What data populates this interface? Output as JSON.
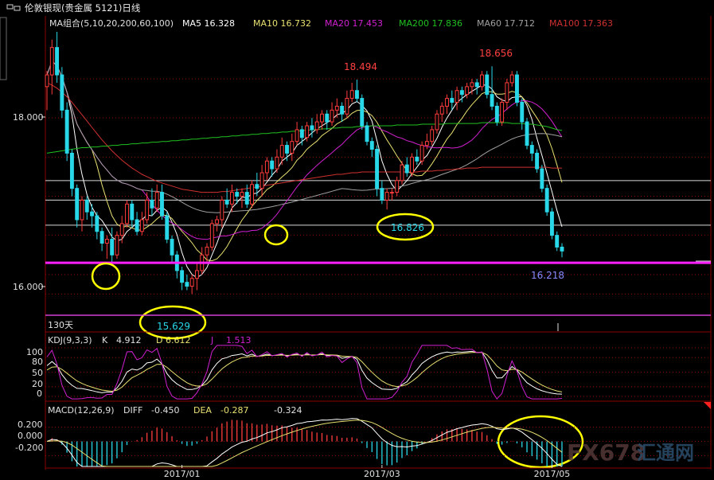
{
  "window": {
    "title": "伦敦银现(贵金属 5121)日线"
  },
  "ma_legend": {
    "group_label": "MA组合(5,10,20,200,60,100)",
    "items": [
      {
        "label": "MA5 16.328",
        "color": "#ffffff"
      },
      {
        "label": "MA10 16.732",
        "color": "#e8e070"
      },
      {
        "label": "MA20 17.453",
        "color": "#d020d0"
      },
      {
        "label": "MA200 17.836",
        "color": "#20c020"
      },
      {
        "label": "MA60 17.712",
        "color": "#a0a0a0"
      },
      {
        "label": "MA100 17.363",
        "color": "#d03030"
      }
    ]
  },
  "price_panel": {
    "y_ticks": [
      "18.000",
      "16.000"
    ],
    "high_labels": [
      "18.494",
      "18.656"
    ],
    "low_labels": [
      "15.629",
      "16.826",
      "16.218"
    ],
    "period_label": "130天"
  },
  "kdj": {
    "label": "KDJ(9,3,3)",
    "k_label": "K",
    "k_value": "4.912",
    "d_label": "D",
    "d_value": "6.612",
    "j_label": "J",
    "j_value": "1.513",
    "y_ticks": [
      "100",
      "80",
      "50",
      "20",
      "0"
    ]
  },
  "macd": {
    "label": "MACD(12,26,9)",
    "diff_label": "DIFF",
    "diff_value": "-0.450",
    "dea_label": "DEA",
    "dea_value": "-0.287",
    "macd_value": "-0.324",
    "y_ticks": [
      "0.200",
      "0.000",
      "-0.200"
    ]
  },
  "x_axis": {
    "ticks": [
      "2017/01",
      "2017/03",
      "2017/05"
    ]
  },
  "watermark": {
    "text": "FX678",
    "subtext": "汇通网"
  },
  "colors": {
    "up": "#ff3c3c",
    "down": "#28d8e8",
    "support": "#ff20ff",
    "highlight": "#ffff00",
    "grid": "#8a0000"
  },
  "chart_data": {
    "type": "candlestick",
    "title": "伦敦银现(贵金属 5121)日线",
    "ylim": [
      15.5,
      19.1
    ],
    "support_level": 16.15,
    "horizontal_lines": [
      17.2,
      16.95,
      16.63
    ],
    "x_ticks": [
      "2017/01",
      "2017/03",
      "2017/05"
    ],
    "x_tick_index": [
      27,
      67,
      101
    ],
    "candles": {
      "open": [
        18.4,
        18.55,
        18.9,
        18.55,
        18.1,
        17.55,
        17.1,
        16.7,
        16.95,
        16.8,
        16.75,
        16.55,
        16.4,
        16.45,
        16.25,
        16.5,
        16.65,
        16.9,
        16.7,
        16.55,
        16.7,
        16.95,
        16.85,
        17.05,
        16.75,
        16.45,
        16.25,
        16.05,
        15.9,
        15.85,
        15.95,
        16.05,
        16.25,
        16.35,
        16.65,
        16.7,
        16.95,
        16.9,
        17.05,
        17.0,
        17.05,
        16.9,
        17.15,
        17.1,
        17.3,
        17.45,
        17.35,
        17.5,
        17.65,
        17.55,
        17.7,
        17.85,
        17.75,
        17.9,
        17.85,
        17.95,
        18.05,
        17.95,
        18.1,
        18.15,
        18.05,
        18.25,
        18.35,
        18.25,
        17.9,
        17.7,
        17.6,
        17.1,
        16.95,
        17.05,
        17.05,
        17.2,
        17.4,
        17.3,
        17.5,
        17.45,
        17.65,
        17.7,
        17.85,
        18.05,
        18.15,
        18.25,
        18.2,
        18.35,
        18.3,
        18.4,
        18.45,
        18.4,
        18.55,
        18.3,
        18.15,
        17.95,
        18.2,
        18.45,
        18.55,
        18.2,
        17.95,
        17.65,
        17.55,
        17.35,
        17.1,
        16.8,
        16.5,
        16.35
      ],
      "high": [
        18.6,
        19.0,
        19.1,
        18.65,
        18.2,
        17.6,
        17.15,
        17.0,
        17.0,
        16.9,
        16.8,
        16.6,
        16.5,
        16.6,
        16.55,
        16.75,
        16.95,
        16.95,
        16.8,
        16.8,
        17.05,
        17.1,
        17.15,
        17.15,
        16.8,
        16.5,
        16.3,
        16.1,
        16.0,
        16.0,
        16.15,
        16.35,
        16.4,
        16.7,
        16.75,
        17.0,
        17.1,
        17.15,
        17.1,
        17.1,
        17.15,
        17.2,
        17.3,
        17.4,
        17.5,
        17.5,
        17.6,
        17.75,
        17.7,
        17.8,
        17.95,
        17.9,
        17.95,
        18.0,
        18.05,
        18.1,
        18.1,
        18.2,
        18.25,
        18.2,
        18.35,
        18.45,
        18.49,
        18.3,
        17.95,
        17.75,
        17.65,
        17.2,
        17.1,
        17.1,
        17.25,
        17.45,
        17.5,
        17.55,
        17.6,
        17.7,
        17.8,
        17.9,
        18.1,
        18.2,
        18.3,
        18.35,
        18.4,
        18.4,
        18.45,
        18.5,
        18.5,
        18.6,
        18.6,
        18.66,
        18.2,
        18.25,
        18.5,
        18.6,
        18.6,
        18.25,
        18.0,
        17.7,
        17.6,
        17.4,
        17.15,
        16.85,
        16.55,
        16.4
      ],
      "low": [
        18.1,
        18.3,
        18.45,
        18.0,
        17.45,
        17.0,
        16.6,
        16.55,
        16.7,
        16.6,
        16.45,
        16.3,
        16.2,
        16.15,
        16.2,
        16.4,
        16.6,
        16.6,
        16.5,
        16.5,
        16.65,
        16.75,
        16.8,
        16.7,
        16.4,
        16.15,
        15.95,
        15.8,
        15.8,
        15.75,
        15.8,
        16.0,
        16.15,
        16.3,
        16.55,
        16.6,
        16.85,
        16.8,
        16.9,
        16.85,
        16.85,
        16.85,
        17.0,
        17.0,
        17.2,
        17.25,
        17.3,
        17.4,
        17.45,
        17.45,
        17.65,
        17.65,
        17.7,
        17.75,
        17.8,
        17.85,
        17.85,
        17.9,
        18.0,
        17.95,
        18.0,
        18.2,
        18.2,
        17.85,
        17.65,
        17.5,
        17.0,
        16.9,
        16.83,
        16.95,
        17.0,
        17.15,
        17.25,
        17.25,
        17.4,
        17.4,
        17.6,
        17.65,
        17.8,
        17.95,
        18.05,
        18.1,
        18.1,
        18.2,
        18.25,
        18.3,
        18.3,
        18.35,
        18.25,
        18.1,
        17.9,
        17.9,
        18.1,
        18.4,
        18.15,
        17.85,
        17.6,
        17.45,
        17.3,
        17.05,
        16.75,
        16.45,
        16.3,
        16.22
      ],
      "close": [
        18.55,
        18.9,
        18.55,
        18.1,
        17.55,
        17.1,
        16.7,
        16.95,
        16.8,
        16.75,
        16.55,
        16.4,
        16.45,
        16.25,
        16.5,
        16.65,
        16.9,
        16.7,
        16.55,
        16.7,
        16.95,
        16.85,
        17.05,
        16.75,
        16.45,
        16.25,
        16.05,
        15.9,
        15.85,
        15.95,
        16.05,
        16.25,
        16.35,
        16.65,
        16.7,
        16.95,
        16.9,
        17.05,
        17.0,
        17.05,
        16.9,
        17.15,
        17.1,
        17.3,
        17.45,
        17.35,
        17.5,
        17.65,
        17.55,
        17.7,
        17.85,
        17.75,
        17.9,
        17.85,
        17.95,
        18.05,
        17.95,
        18.1,
        18.15,
        18.05,
        18.25,
        18.35,
        18.25,
        17.9,
        17.7,
        17.6,
        17.1,
        16.95,
        17.05,
        17.05,
        17.2,
        17.4,
        17.3,
        17.5,
        17.45,
        17.65,
        17.7,
        17.85,
        18.05,
        18.15,
        18.25,
        18.2,
        18.35,
        18.3,
        18.4,
        18.45,
        18.4,
        18.55,
        18.3,
        18.15,
        17.95,
        18.2,
        18.45,
        18.55,
        18.2,
        17.95,
        17.65,
        17.55,
        17.35,
        17.1,
        16.8,
        16.5,
        16.35,
        16.3
      ]
    },
    "ma_series": [
      {
        "name": "MA5",
        "color": "#ffffff"
      },
      {
        "name": "MA10",
        "color": "#e8e070"
      },
      {
        "name": "MA20",
        "color": "#d020d0"
      },
      {
        "name": "MA60",
        "color": "#a0a0a0"
      },
      {
        "name": "MA100",
        "color": "#d03030",
        "values": [
          18.45,
          18.42,
          18.38,
          18.33,
          18.27,
          18.2,
          18.12,
          18.04,
          17.96,
          17.88,
          17.8,
          17.72,
          17.65,
          17.58,
          17.52,
          17.46,
          17.41,
          17.36,
          17.32,
          17.28,
          17.25,
          17.22,
          17.19,
          17.17,
          17.15,
          17.13,
          17.11,
          17.09,
          17.08,
          17.07,
          17.06,
          17.05,
          17.05,
          17.05,
          17.05,
          17.06,
          17.06,
          17.07,
          17.08,
          17.09,
          17.1,
          17.11,
          17.12,
          17.13,
          17.14,
          17.15,
          17.16,
          17.17,
          17.18,
          17.19,
          17.2,
          17.21,
          17.22,
          17.23,
          17.24,
          17.25,
          17.26,
          17.27,
          17.28,
          17.28,
          17.29,
          17.3,
          17.3,
          17.31,
          17.31,
          17.31,
          17.31,
          17.31,
          17.31,
          17.31,
          17.31,
          17.31,
          17.31,
          17.31,
          17.31,
          17.32,
          17.32,
          17.32,
          17.33,
          17.33,
          17.34,
          17.34,
          17.35,
          17.35,
          17.36,
          17.36,
          17.36,
          17.37,
          17.37,
          17.37,
          17.37,
          17.37,
          17.37,
          17.37,
          17.37,
          17.37,
          17.37,
          17.37,
          17.37,
          17.37,
          17.37,
          17.36,
          17.36,
          17.36
        ]
      },
      {
        "name": "MA200",
        "color": "#20c020",
        "values": [
          17.55,
          17.56,
          17.57,
          17.58,
          17.59,
          17.6,
          17.61,
          17.62,
          17.62,
          17.63,
          17.63,
          17.64,
          17.64,
          17.65,
          17.65,
          17.66,
          17.66,
          17.67,
          17.67,
          17.68,
          17.68,
          17.69,
          17.69,
          17.7,
          17.7,
          17.71,
          17.71,
          17.72,
          17.72,
          17.73,
          17.73,
          17.74,
          17.74,
          17.75,
          17.75,
          17.76,
          17.76,
          17.77,
          17.77,
          17.78,
          17.78,
          17.79,
          17.79,
          17.8,
          17.8,
          17.81,
          17.81,
          17.82,
          17.82,
          17.83,
          17.83,
          17.84,
          17.84,
          17.85,
          17.85,
          17.86,
          17.86,
          17.87,
          17.87,
          17.88,
          17.88,
          17.88,
          17.89,
          17.89,
          17.89,
          17.9,
          17.9,
          17.9,
          17.9,
          17.9,
          17.91,
          17.91,
          17.91,
          17.91,
          17.91,
          17.92,
          17.92,
          17.92,
          17.92,
          17.92,
          17.93,
          17.93,
          17.93,
          17.93,
          17.93,
          17.93,
          17.93,
          17.94,
          17.94,
          17.94,
          17.94,
          17.94,
          17.94,
          17.93,
          17.93,
          17.93,
          17.92,
          17.92,
          17.91,
          17.9,
          17.89,
          17.87,
          17.85,
          17.84
        ]
      }
    ],
    "kdj": {
      "ylim": [
        0,
        100
      ]
    },
    "macd": {
      "ylim": [
        -0.35,
        0.35
      ]
    }
  }
}
